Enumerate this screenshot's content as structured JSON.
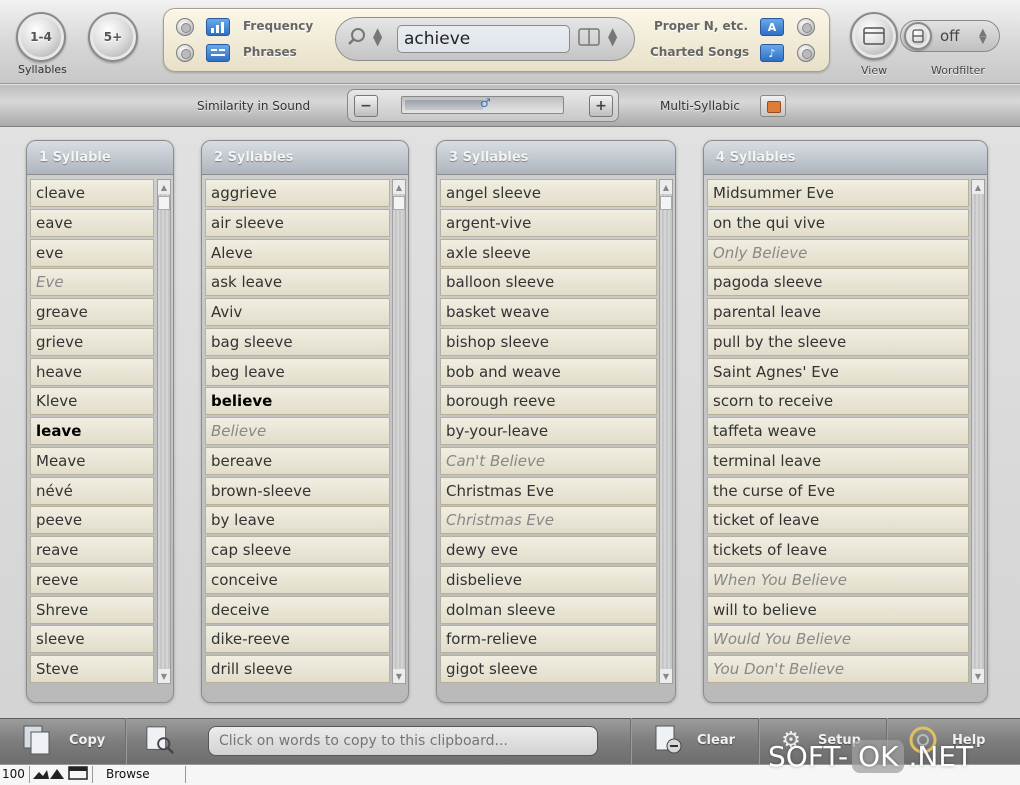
{
  "toolbar": {
    "syllable_buttons": [
      "1-4",
      "5+"
    ],
    "syllables_label": "Syllables",
    "frequency_label": "Frequency",
    "phrases_label": "Phrases",
    "search_value": "achieve",
    "proper_label": "Proper N, etc.",
    "charted_label": "Charted Songs",
    "proper_icon": "A",
    "charted_icon": "♪",
    "view_label": "View",
    "wordfilter_label": "Wordfilter",
    "wordfilter_value": "off"
  },
  "simbar": {
    "similarity_label": "Similarity in Sound",
    "minus": "−",
    "plus": "+",
    "slider_level": 0.5,
    "multi_label": "Multi-Syllabic"
  },
  "columns": [
    {
      "title": "1 Syllable",
      "words": [
        {
          "text": "cleave",
          "style": "normal"
        },
        {
          "text": "eave",
          "style": "normal"
        },
        {
          "text": "eve",
          "style": "normal"
        },
        {
          "text": "Eve",
          "style": "italic"
        },
        {
          "text": "greave",
          "style": "normal"
        },
        {
          "text": "grieve",
          "style": "normal"
        },
        {
          "text": "heave",
          "style": "normal"
        },
        {
          "text": "Kleve",
          "style": "normal"
        },
        {
          "text": "leave",
          "style": "bold"
        },
        {
          "text": "Meave",
          "style": "normal"
        },
        {
          "text": "névé",
          "style": "normal"
        },
        {
          "text": "peeve",
          "style": "normal"
        },
        {
          "text": "reave",
          "style": "normal"
        },
        {
          "text": "reeve",
          "style": "normal"
        },
        {
          "text": "Shreve",
          "style": "normal"
        },
        {
          "text": "sleeve",
          "style": "normal"
        },
        {
          "text": "Steve",
          "style": "normal"
        }
      ]
    },
    {
      "title": "2 Syllables",
      "words": [
        {
          "text": "aggrieve",
          "style": "normal"
        },
        {
          "text": "air sleeve",
          "style": "normal"
        },
        {
          "text": "Aleve",
          "style": "normal"
        },
        {
          "text": "ask leave",
          "style": "normal"
        },
        {
          "text": "Aviv",
          "style": "normal"
        },
        {
          "text": "bag sleeve",
          "style": "normal"
        },
        {
          "text": "beg leave",
          "style": "normal"
        },
        {
          "text": "believe",
          "style": "bold"
        },
        {
          "text": "Believe",
          "style": "italic"
        },
        {
          "text": "bereave",
          "style": "normal"
        },
        {
          "text": "brown-sleeve",
          "style": "normal"
        },
        {
          "text": "by leave",
          "style": "normal"
        },
        {
          "text": "cap sleeve",
          "style": "normal"
        },
        {
          "text": "conceive",
          "style": "normal"
        },
        {
          "text": "deceive",
          "style": "normal"
        },
        {
          "text": "dike-reeve",
          "style": "normal"
        },
        {
          "text": "drill sleeve",
          "style": "normal"
        }
      ]
    },
    {
      "title": "3 Syllables",
      "words": [
        {
          "text": "angel sleeve",
          "style": "normal"
        },
        {
          "text": "argent-vive",
          "style": "normal"
        },
        {
          "text": "axle sleeve",
          "style": "normal"
        },
        {
          "text": "balloon sleeve",
          "style": "normal"
        },
        {
          "text": "basket weave",
          "style": "normal"
        },
        {
          "text": "bishop sleeve",
          "style": "normal"
        },
        {
          "text": "bob and weave",
          "style": "normal"
        },
        {
          "text": "borough reeve",
          "style": "normal"
        },
        {
          "text": "by-your-leave",
          "style": "normal"
        },
        {
          "text": "Can't Believe",
          "style": "italic"
        },
        {
          "text": "Christmas Eve",
          "style": "normal"
        },
        {
          "text": "Christmas Eve",
          "style": "italic"
        },
        {
          "text": "dewy eve",
          "style": "normal"
        },
        {
          "text": "disbelieve",
          "style": "normal"
        },
        {
          "text": "dolman sleeve",
          "style": "normal"
        },
        {
          "text": "form-relieve",
          "style": "normal"
        },
        {
          "text": "gigot sleeve",
          "style": "normal"
        }
      ]
    },
    {
      "title": "4 Syllables",
      "words": [
        {
          "text": "Midsummer Eve",
          "style": "normal"
        },
        {
          "text": "on the qui vive",
          "style": "normal"
        },
        {
          "text": "Only Believe",
          "style": "italic"
        },
        {
          "text": "pagoda sleeve",
          "style": "normal"
        },
        {
          "text": "parental leave",
          "style": "normal"
        },
        {
          "text": "pull by the sleeve",
          "style": "normal"
        },
        {
          "text": "Saint Agnes' Eve",
          "style": "normal"
        },
        {
          "text": "scorn to receive",
          "style": "normal"
        },
        {
          "text": "taffeta weave",
          "style": "normal"
        },
        {
          "text": "terminal leave",
          "style": "normal"
        },
        {
          "text": "the curse of Eve",
          "style": "normal"
        },
        {
          "text": "ticket of leave",
          "style": "normal"
        },
        {
          "text": "tickets of leave",
          "style": "normal"
        },
        {
          "text": "When You Believe",
          "style": "italic"
        },
        {
          "text": "will to believe",
          "style": "normal"
        },
        {
          "text": "Would You Believe",
          "style": "italic"
        },
        {
          "text": "You Don't Believe",
          "style": "italic"
        }
      ]
    }
  ],
  "bottombar": {
    "copy_label": "Copy",
    "clipboard_value": "Click on words to copy to this clipboard...",
    "clear_label": "Clear",
    "setup_label": "Setup",
    "help_label": "Help"
  },
  "statusbar": {
    "zoom": "100",
    "mode": "Browse"
  },
  "watermark": {
    "part1": "SOFT-",
    "part2": "OK",
    "part3": ".NET"
  }
}
